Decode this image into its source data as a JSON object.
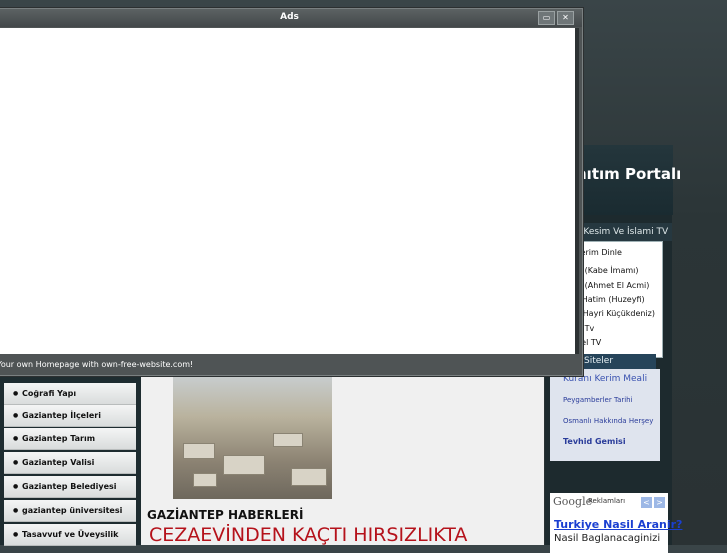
{
  "window": {
    "title": "Ads",
    "footer_text": "Your own Homepage with own-free-website.com!",
    "buttons": [
      "restore",
      "close"
    ]
  },
  "portal": {
    "title": "nıtım Portalı"
  },
  "tv": {
    "header": "ı Kesim Ve İslami TV",
    "items": [
      "n-ı Kerim Dinle",
      "n (Kabe İmamı)",
      "n (Ahmet El Acmi)",
      "i Hatim (Huzeyfi)",
      "( Hayri Küçükdeniz)",
      "n Tv",
      "sel TV"
    ]
  },
  "siteler": {
    "header": "Siteler",
    "links": [
      "Kuranı Kerim Meali",
      "Peygamberler Tarihi",
      "Osmanlı Hakkında Herşey",
      "Tevhid Gemisi"
    ]
  },
  "google_ads": {
    "logo": "Google",
    "label": "Reklamları",
    "prev": "<",
    "next": ">",
    "ad_title": "Turkiye Nasil Aranir?",
    "ad_text": "Nasil Baglanacaginizi"
  },
  "left_nav": {
    "items": [
      "Coğrafi Yapı",
      "Gaziantep İlçeleri",
      "Gaziantep Tarım",
      "Gaziantep Valisi",
      "Gaziantep Belediyesi",
      "gaziantep üniversitesi",
      "Tasavvuf ve Üveysilik"
    ]
  },
  "main": {
    "news_heading": "GAZİANTEP HABERLERİ",
    "headline": "CEZAEVİNDEN KAÇTI HIRSIZLIKTA"
  },
  "colors": {
    "headline": "#b5121b",
    "link": "#1a3fd1",
    "dark_bg": "#2b3537"
  }
}
